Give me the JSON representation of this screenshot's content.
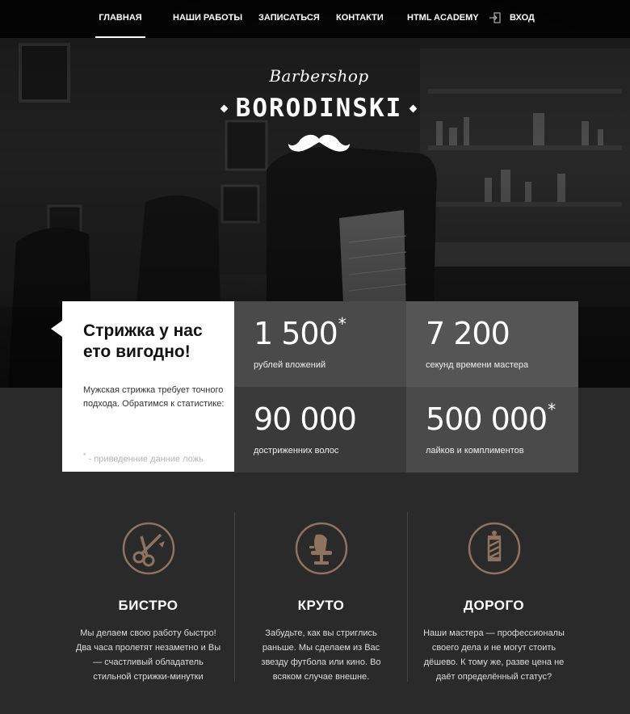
{
  "nav": {
    "items": [
      {
        "label": "ГЛАВНАЯ",
        "active": true
      },
      {
        "label": "НАШИ РАБОТЫ",
        "active": false
      },
      {
        "label": "ЗАПИСАТЬСЯ",
        "active": false
      },
      {
        "label": "КОНТАКТИ",
        "active": false
      },
      {
        "label": "HTML ACADEMY",
        "active": false
      }
    ],
    "login_label": "ВХОД",
    "login_icon": "login-icon"
  },
  "logo": {
    "script": "Barbershop",
    "main": "BORODINSKI",
    "icon": "mustache-icon"
  },
  "stats": {
    "intro_title": "Стрижка у нас ето вигодно!",
    "intro_text": "Мужская стрижка требует точного подхода. Обратимся к статистике:",
    "intro_note_mark": "*",
    "intro_note": " - приведенние данние ложь",
    "items": [
      {
        "value": "1 500",
        "mark": "*",
        "label": "рублей вложений"
      },
      {
        "value": "7 200",
        "mark": "",
        "label": "секунд времени мастера"
      },
      {
        "value": "90 000",
        "mark": "",
        "label": "достриженних волос"
      },
      {
        "value": "500 000",
        "mark": "*",
        "label": "лайков и комплиментов"
      }
    ]
  },
  "features": [
    {
      "icon": "scissors-icon",
      "title": "БИСТРО",
      "text": "Мы делаем свою работу быстро! Два часа пролетят незаметно и Вы — счастливый обладатель стильной стрижки-минутки"
    },
    {
      "icon": "barber-chair-icon",
      "title": "КРУТО",
      "text": "Забудьте, как вы стриглись раньше. Мы сделаем из Вас звезду футбола или кино. Во всяком случае внешне."
    },
    {
      "icon": "barber-pole-icon",
      "title": "ДОРОГО",
      "text": "Наши мастера — профессионалы своего дела и не могут стоить дёшево. К тому же, разве цена не даёт определённый статус?"
    }
  ],
  "colors": {
    "accent": "#8f7360",
    "page_bg": "#2a2a2a",
    "stat_dark": "#4a4a4a",
    "stat_darker": "#3a3a3a"
  }
}
